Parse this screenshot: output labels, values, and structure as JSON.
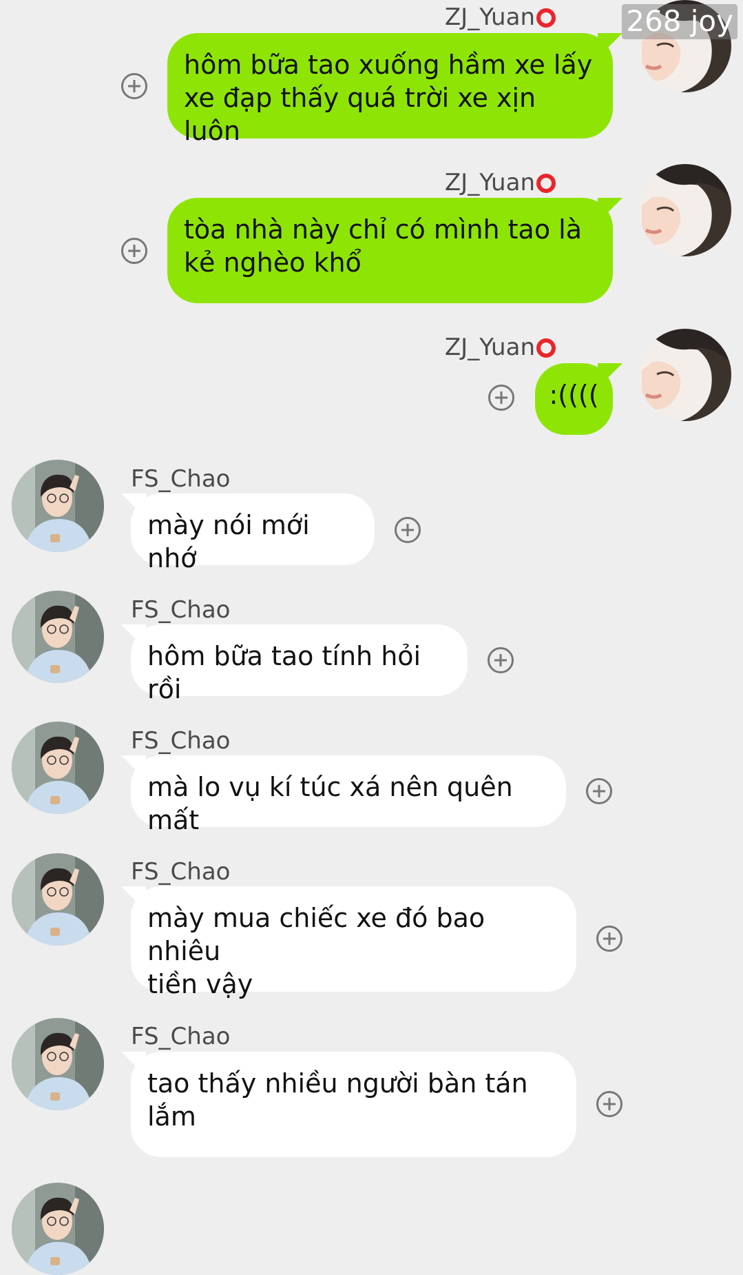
{
  "overlay": {
    "joy_label": "268 joy"
  },
  "colors": {
    "background": "#eeeeee",
    "outgoing_bubble": "#8ee505",
    "incoming_bubble": "#ffffff",
    "status_ring": "#e8262c"
  },
  "messages": [
    {
      "direction": "outgoing",
      "sender": "ZJ_Yuan",
      "line1": "hôm bữa tao xuống hầm xe lấy",
      "line2": "xe đạp thấy quá trời xe xịn luôn"
    },
    {
      "direction": "outgoing",
      "sender": "ZJ_Yuan",
      "line1": "tòa nhà này chỉ có mình tao là",
      "line2": "kẻ nghèo khổ"
    },
    {
      "direction": "outgoing",
      "sender": "ZJ_Yuan",
      "line1": ":((((",
      "line2": ""
    },
    {
      "direction": "incoming",
      "sender": "FS_Chao",
      "line1": "mày nói mới nhớ",
      "line2": ""
    },
    {
      "direction": "incoming",
      "sender": "FS_Chao",
      "line1": "hôm bữa tao tính hỏi rồi",
      "line2": ""
    },
    {
      "direction": "incoming",
      "sender": "FS_Chao",
      "line1": "mà lo vụ kí túc xá nên quên mất",
      "line2": ""
    },
    {
      "direction": "incoming",
      "sender": "FS_Chao",
      "line1": "mày mua chiếc xe đó bao nhiêu",
      "line2": "tiền vậy"
    },
    {
      "direction": "incoming",
      "sender": "FS_Chao",
      "line1": "tao thấy nhiều người bàn tán",
      "line2": "lắm"
    }
  ]
}
